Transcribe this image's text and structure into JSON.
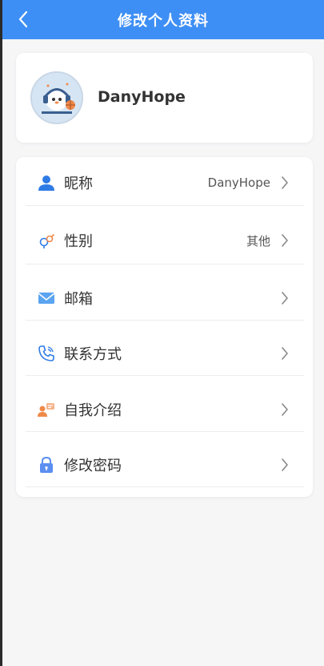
{
  "header": {
    "title": "修改个人资料"
  },
  "profile": {
    "username": "DanyHope"
  },
  "menu": {
    "items": [
      {
        "label": "昵称",
        "value": "DanyHope"
      },
      {
        "label": "性别",
        "value": "其他"
      },
      {
        "label": "邮箱",
        "value": ""
      },
      {
        "label": "联系方式",
        "value": ""
      },
      {
        "label": "自我介绍",
        "value": ""
      },
      {
        "label": "修改密码",
        "value": ""
      }
    ]
  },
  "colors": {
    "header": "#3e8ff5",
    "icon_blue": "#2f7be6",
    "icon_orange": "#f08a4b",
    "background": "#f6f6f7"
  }
}
